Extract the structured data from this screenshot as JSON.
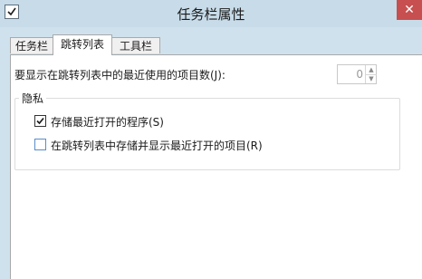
{
  "window": {
    "title": "任务栏属性",
    "close_symbol": "✕"
  },
  "tabs": [
    {
      "label": "任务栏",
      "active": false
    },
    {
      "label": "跳转列表",
      "active": true
    },
    {
      "label": "工具栏",
      "active": false
    }
  ],
  "jumplist": {
    "count_label": "要显示在跳转列表中的最近使用的项目数(J):",
    "count_value": "0"
  },
  "privacy": {
    "legend": "隐私",
    "options": [
      {
        "label": "存储最近打开的程序(S)",
        "checked": true
      },
      {
        "label": "在跳转列表中存储并显示最近打开的项目(R)",
        "checked": false
      }
    ]
  },
  "colors": {
    "titlebar": "#c7dbe8",
    "close_button": "#c74f4f",
    "checkbox_unchecked_border": "#5a8dc7"
  },
  "icons": [
    "app-checkbox-icon",
    "close-icon",
    "spin-up-icon",
    "spin-down-icon",
    "checkmark-icon"
  ]
}
